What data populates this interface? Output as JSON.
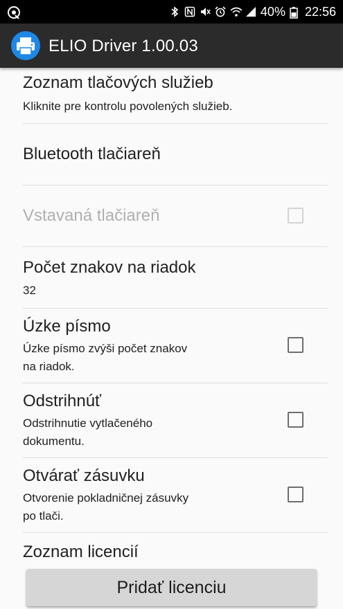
{
  "status_bar": {
    "battery_text": "40%",
    "time": "22:56",
    "left_icon": "app-notification-icon",
    "right_icons": [
      "bluetooth-icon",
      "nfc-icon",
      "mute-icon",
      "alarm-icon",
      "wifi-icon",
      "signal-icon",
      "battery-icon"
    ]
  },
  "app_bar": {
    "title": "ELIO Driver 1.00.03",
    "icon": "printer-icon",
    "icon_color": "#1e88e5"
  },
  "preferences": {
    "services": {
      "title": "Zoznam tlačových služieb",
      "summary": "Kliknite pre kontrolu povolených služieb."
    },
    "bluetooth": {
      "title": "Bluetooth tlačiareň"
    },
    "builtin": {
      "title": "Vstavaná tlačiareň",
      "checked": false,
      "enabled": false
    },
    "chars_per_line": {
      "title": "Počet znakov na riadok",
      "summary": "32"
    },
    "narrow_font": {
      "title": "Úzke písmo",
      "summary_line1": "Úzke písmo zvýši počet znakov",
      "summary_line2": "na riadok.",
      "checked": false
    },
    "cut": {
      "title": "Odstrihnúť",
      "summary_line1": "Odstrihnutie vytlačeného",
      "summary_line2": "dokumentu.",
      "checked": false
    },
    "drawer": {
      "title": "Otvárať zásuvku",
      "summary_line1": "Otvorenie pokladničnej zásuvky",
      "summary_line2": "po tlači.",
      "checked": false
    },
    "licenses": {
      "title": "Zoznam licencií"
    }
  },
  "add_license_button": {
    "label": "Pridať licenciu"
  }
}
